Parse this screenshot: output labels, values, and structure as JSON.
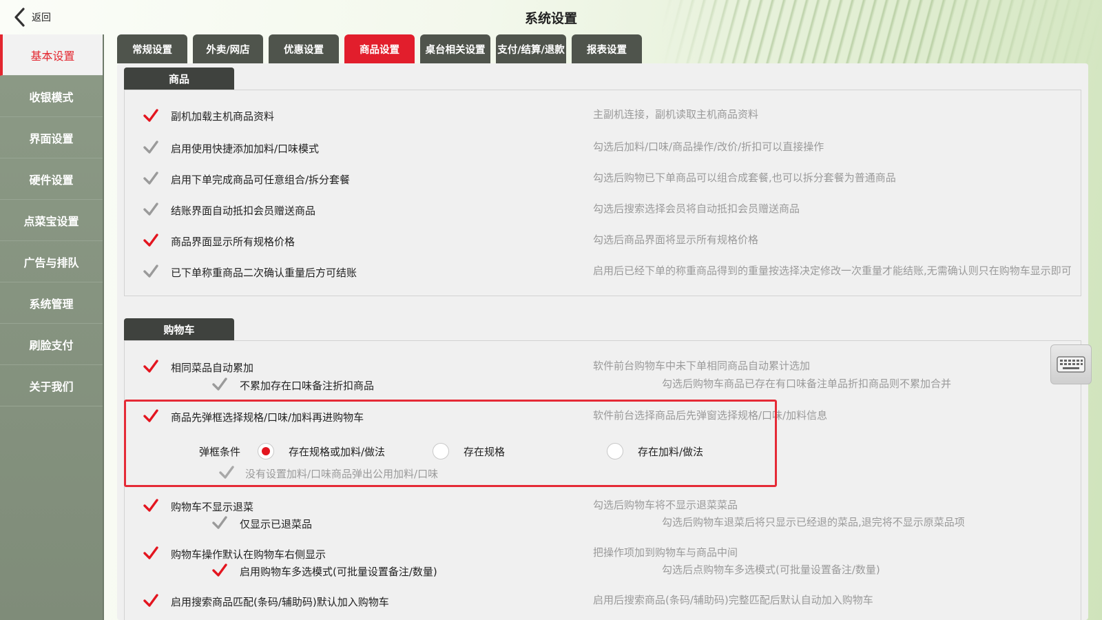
{
  "header": {
    "back_label": "返回",
    "title": "系统设置"
  },
  "sidebar": {
    "items": [
      {
        "label": "基本设置",
        "active": true
      },
      {
        "label": "收银模式",
        "active": false
      },
      {
        "label": "界面设置",
        "active": false
      },
      {
        "label": "硬件设置",
        "active": false
      },
      {
        "label": "点菜宝设置",
        "active": false
      },
      {
        "label": "广告与排队",
        "active": false
      },
      {
        "label": "系统管理",
        "active": false
      },
      {
        "label": "刷脸支付",
        "active": false
      },
      {
        "label": "关于我们",
        "active": false
      }
    ]
  },
  "tabs": [
    {
      "label": "常规设置",
      "active": false
    },
    {
      "label": "外卖/网店",
      "active": false
    },
    {
      "label": "优惠设置",
      "active": false
    },
    {
      "label": "商品设置",
      "active": true
    },
    {
      "label": "桌台相关设置",
      "active": false
    },
    {
      "label": "支付/结算/退款",
      "active": false
    },
    {
      "label": "报表设置",
      "active": false
    }
  ],
  "sections": {
    "goods": {
      "title": "商品",
      "options": [
        {
          "label": "副机加载主机商品资料",
          "checked": true,
          "desc": "主副机连接，副机读取主机商品资料"
        },
        {
          "label": "启用使用快捷添加加料/口味模式",
          "checked": false,
          "desc": "勾选后加料/口味/商品操作/改价/折扣可以直接操作"
        },
        {
          "label": "启用下单完成商品可任意组合/拆分套餐",
          "checked": false,
          "desc": "勾选后购物已下单商品可以组合成套餐,也可以拆分套餐为普通商品"
        },
        {
          "label": "结账界面自动抵扣会员赠送商品",
          "checked": false,
          "desc": "勾选后搜索选择会员将自动抵扣会员赠送商品"
        },
        {
          "label": "商品界面显示所有规格价格",
          "checked": true,
          "desc": "勾选后商品界面将显示所有规格价格"
        },
        {
          "label": "已下单称重商品二次确认重量后方可结账",
          "checked": false,
          "desc": "启用后已经下单的称重商品得到的重量按选择决定修改一次重量才能结账,无需确认则只在购物车显示即可"
        }
      ]
    },
    "cart": {
      "title": "购物车",
      "options": [
        {
          "label": "相同菜品自动累加",
          "checked": true,
          "desc": "软件前台购物车中未下单相同商品自动累计选加"
        },
        {
          "label": "不累加存在口味备注折扣商品",
          "checked": false,
          "desc": "勾选后购物车商品已存在有口味备注单品折扣商品则不累加合并"
        },
        {
          "label": "商品先弹框选择规格/口味/加料再进购物车",
          "checked": true,
          "desc": "软件前台选择商品后先弹窗选择规格/口味/加料信息"
        },
        {
          "label": "没有设置加料/口味商品弹出公用加料/口味",
          "checked": false,
          "desc": ""
        },
        {
          "label": "购物车不显示退菜",
          "checked": true,
          "desc": "勾选后购物车将不显示退菜菜品"
        },
        {
          "label": "仅显示已退菜品",
          "checked": false,
          "desc": "勾选后购物车退菜后将只显示已经退的菜品,退完将不显示原菜品项"
        },
        {
          "label": "购物车操作默认在购物车右侧显示",
          "checked": true,
          "desc": "把操作项加到购物车与商品中间"
        },
        {
          "label": "启用购物车多选模式(可批量设置备注/数量)",
          "checked": true,
          "desc": "勾选后点购物车多选模式(可批量设置备注/数量)"
        },
        {
          "label": "启用搜索商品匹配(条码/辅助码)默认加入购物车",
          "checked": true,
          "desc": "启用后搜索商品(条码/辅助码)完整匹配后默认自动加入购物车"
        }
      ],
      "popup_condition": {
        "label": "弹框条件",
        "choices": [
          {
            "label": "存在规格或加料/做法",
            "selected": true
          },
          {
            "label": "存在规格",
            "selected": false
          },
          {
            "label": "存在加料/做法",
            "selected": false
          }
        ]
      }
    }
  },
  "colors": {
    "accent": "#e21e2c",
    "tab_bg": "#4f544c",
    "sidebar_bg": "#8c9a86"
  }
}
